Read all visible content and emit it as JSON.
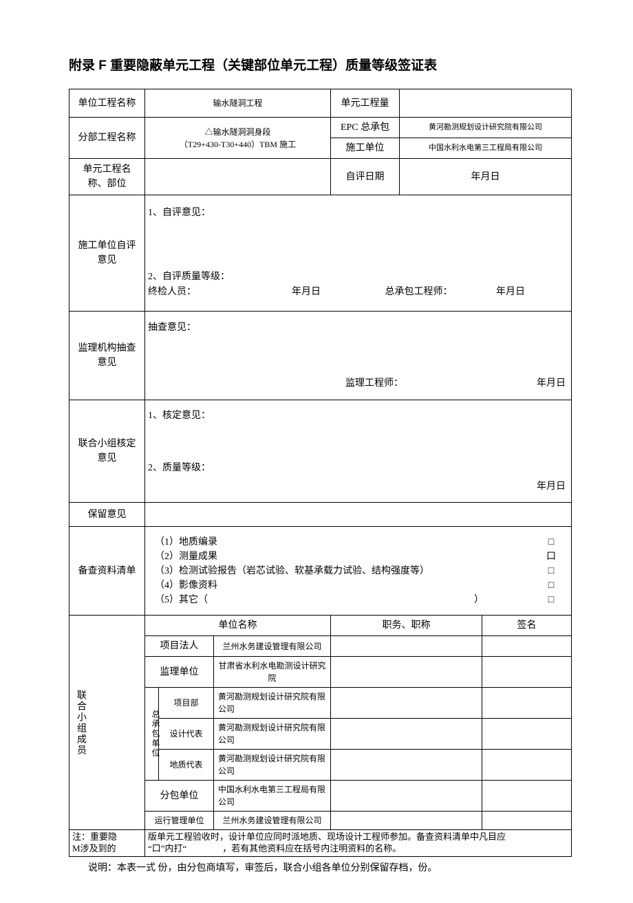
{
  "title": "附录 F 重要隐蔽单元工程（关键部位单元工程）质量等级签证表",
  "labels": {
    "unit_project_name": "单位工程名称",
    "subproject_name": "分部工程名称",
    "unit_name_part": "单元工程名称、部位",
    "unit_quantity": "单元工程量",
    "epc": "EPC 总承包",
    "construction_unit": "施工单位",
    "self_eval_date": "自评日期",
    "construction_self_opinion": "施工单位自评意见",
    "supervision_opinion": "监理机构抽查意见",
    "joint_group_opinion": "联合小组核定意见",
    "reserved_opinion": "保留意见",
    "checklist": "备查资料清单",
    "joint_group_members": "联合小组成员",
    "unit_name_col": "单位名称",
    "position_col": "职务、职称",
    "sign_col": "签名",
    "project_legal": "项目法人",
    "supervision_unit": "监理单位",
    "general_contract_unit": "总承包单位",
    "project_dept": "项目部",
    "design_rep": "设计代表",
    "geo_rep": "地质代表",
    "subcontractor": "分包单位",
    "operation_unit": "运行管理单位"
  },
  "values": {
    "unit_project_name": "输水隧洞工程",
    "subproject_name_l1": "△输水隧洞洞身段",
    "subproject_name_l2": "（T29+430-T30+440）TBM 施工",
    "epc_unit": "黄河勘测规划设计研究院有限公司",
    "construction_unit": "中国水利水电第三工程局有限公司",
    "date_placeholder": "年月日"
  },
  "opinions": {
    "self_1": "1、自评意见：",
    "self_2": "2、自评质量等级：",
    "self_sig_inspector": "终检人员：",
    "self_sig_engineer": "总承包工程师：",
    "inspect_head": "抽查意见：",
    "inspect_sig": "监理工程师：",
    "joint_1": "1、核定意见：",
    "joint_2": "2、质量等级："
  },
  "checklist": {
    "i1": "（1）地质编录",
    "i2": "（2）测量成果",
    "i3": "（3）检测试验报告（岩芯试验、软基承载力试验、结构强度等）",
    "i4": "（4）影像资料",
    "i5_prefix": "（5）其它（",
    "i5_suffix": "）",
    "box": "□",
    "box_alt": "口"
  },
  "members": {
    "project_legal_unit": "兰州水务建设管理有限公司",
    "supervision_unit_name": "甘肃省水利水电勘测设计研究院",
    "gc_project_dept": "黄河勘测规划设计研究院有限公司",
    "gc_design_rep": "黄河勘测规划设计研究院有限公司",
    "gc_geo_rep": "黄河勘测规划设计研究院有限公司",
    "subcontractor_name": "中国水利水电第三工程局有限公司",
    "operation_unit_name": "兰州水务建设管理有限公司"
  },
  "footer": {
    "note_label1": "注：重要隐",
    "note_label2": "M涉及到的",
    "note_text1_a": "版单元工程验收时，设计单位应同时派地质、现场设计工程师参加。备查资料清单中凡目应",
    "note_text1_b": "“口”内打“　　　　，若有其他资料应在括号内注明资料的名称。",
    "explain": "说明：本表一式 份，由分包商填写，审签后，联合小组各单位分别保留存档，份。"
  }
}
